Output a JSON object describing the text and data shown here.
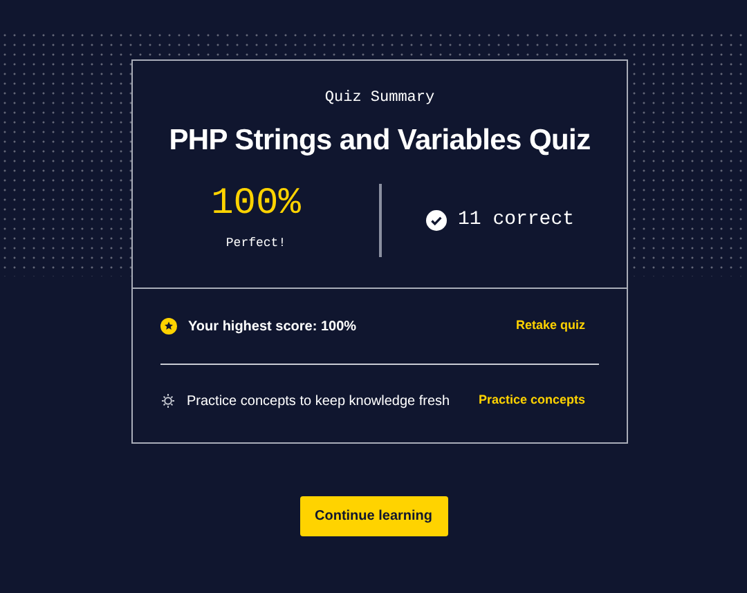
{
  "summary": {
    "label": "Quiz Summary",
    "title": "PHP Strings and Variables Quiz",
    "score": "100%",
    "score_caption": "Perfect!",
    "correct": "11 correct"
  },
  "actions": [
    {
      "kind": "star",
      "text": "Your highest score: 100%",
      "link": "Retake quiz"
    },
    {
      "kind": "bulb",
      "text": "Practice concepts to keep knowledge fresh",
      "link": "Practice concepts"
    }
  ],
  "button": "Continue learning"
}
